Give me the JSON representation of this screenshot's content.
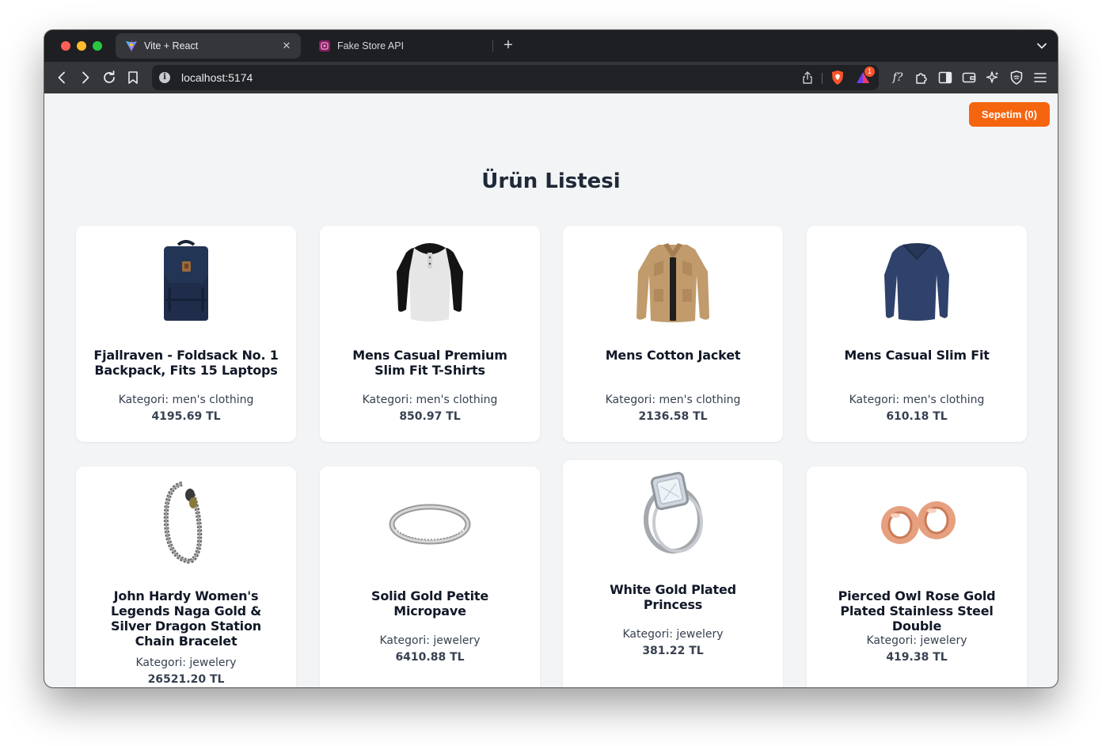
{
  "browser": {
    "tabs": [
      {
        "title": "Vite + React",
        "favicon": "vite-icon",
        "active": true
      },
      {
        "title": "Fake Store API",
        "favicon": "fakestore-icon",
        "active": false
      }
    ],
    "url": "localhost:5174",
    "shields_badge": "1"
  },
  "header": {
    "cart_label": "Sepetim (0)"
  },
  "page": {
    "title": "Ürün Listesi"
  },
  "products": [
    {
      "title": "Fjallraven - Foldsack No. 1 Backpack, Fits 15 Laptops",
      "category": "Kategori: men's clothing",
      "price": "4195.69 TL",
      "image": "backpack"
    },
    {
      "title": "Mens Casual Premium Slim Fit T-Shirts",
      "category": "Kategori: men's clothing",
      "price": "850.97 TL",
      "image": "tshirt"
    },
    {
      "title": "Mens Cotton Jacket",
      "category": "Kategori: men's clothing",
      "price": "2136.58 TL",
      "image": "jacket"
    },
    {
      "title": "Mens Casual Slim Fit",
      "category": "Kategori: men's clothing",
      "price": "610.18 TL",
      "image": "longsleeve"
    },
    {
      "title": "John Hardy Women's Legends Naga Gold & Silver Dragon Station Chain Bracelet",
      "category": "Kategori: jewelery",
      "price": "26521.20 TL",
      "image": "bracelet"
    },
    {
      "title": "Solid Gold Petite Micropave",
      "category": "Kategori: jewelery",
      "price": "6410.88 TL",
      "image": "ring"
    },
    {
      "title": "White Gold Plated Princess",
      "category": "Kategori: jewelery",
      "price": "381.22 TL",
      "image": "princess-ring"
    },
    {
      "title": "Pierced Owl Rose Gold Plated Stainless Steel Double",
      "category": "Kategori: jewelery",
      "price": "419.38 TL",
      "image": "ear-tunnels"
    }
  ],
  "colors": {
    "accent": "#f56510",
    "page_bg": "#f3f4f6",
    "card_bg": "#ffffff",
    "text": "#111827"
  }
}
